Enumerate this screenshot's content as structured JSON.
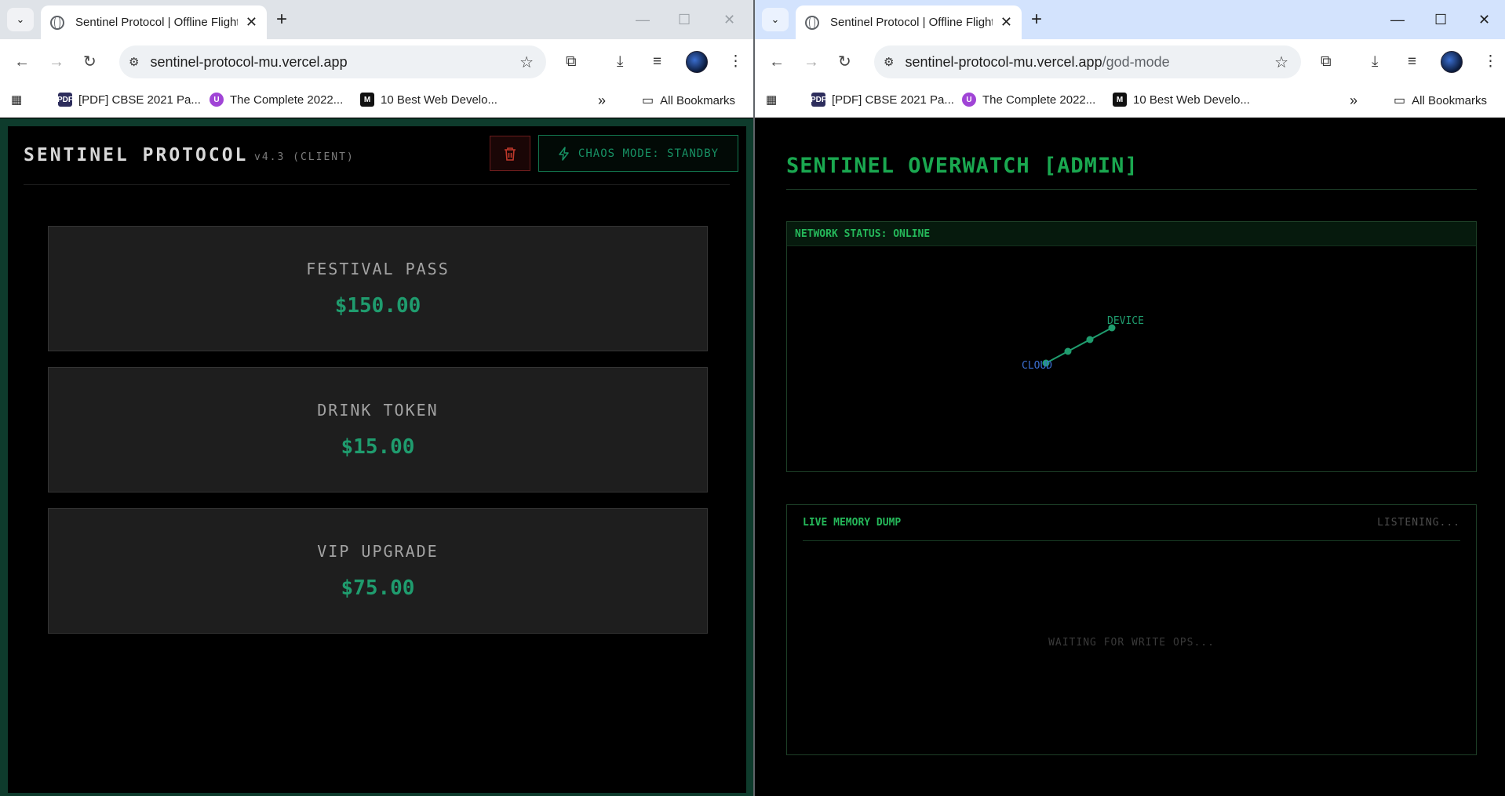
{
  "left_window": {
    "tab_title": "Sentinel Protocol | Offline Flight",
    "url_host": "sentinel-protocol-mu.vercel.app",
    "url_path": "",
    "bookmarks": [
      {
        "label": "[PDF] CBSE 2021 Pa...",
        "icon_color": "#2d2d5c"
      },
      {
        "label": "The Complete 2022...",
        "icon_color": "#a044d6"
      },
      {
        "label": "10 Best Web Develo...",
        "icon_color": "#111111"
      }
    ],
    "bookmarks_more": "»",
    "all_bookmarks": "All Bookmarks"
  },
  "right_window": {
    "tab_title": "Sentinel Protocol | Offline Flight",
    "url_host": "sentinel-protocol-mu.vercel.app",
    "url_path": "/god-mode",
    "bookmarks": [
      {
        "label": "[PDF] CBSE 2021 Pa...",
        "icon_color": "#2d2d5c"
      },
      {
        "label": "The Complete 2022...",
        "icon_color": "#a044d6"
      },
      {
        "label": "10 Best Web Develo...",
        "icon_color": "#111111"
      }
    ],
    "bookmarks_more": "»",
    "all_bookmarks": "All Bookmarks"
  },
  "client": {
    "title": "SENTINEL PROTOCOL",
    "version": "v4.3 (CLIENT)",
    "chaos_button": "CHAOS MODE: STANDBY",
    "products": [
      {
        "name": "FESTIVAL PASS",
        "price": "$150.00"
      },
      {
        "name": "DRINK TOKEN",
        "price": "$15.00"
      },
      {
        "name": "VIP UPGRADE",
        "price": "$75.00"
      }
    ],
    "colors": {
      "accent": "#1f9c6e",
      "frame": "#0e3b2c",
      "danger": "#c0392b"
    }
  },
  "admin": {
    "title": "SENTINEL OVERWATCH [ADMIN]",
    "network_status": "NETWORK STATUS: ONLINE",
    "network_nodes": {
      "source": "CLOUD",
      "target": "DEVICE"
    },
    "memory_title": "LIVE MEMORY DUMP",
    "memory_status": "LISTENING...",
    "memory_empty": "WAITING FOR WRITE OPS...",
    "colors": {
      "accent": "#1aa850",
      "cloud": "#3b6fd1",
      "device": "#1f9c6e"
    }
  }
}
